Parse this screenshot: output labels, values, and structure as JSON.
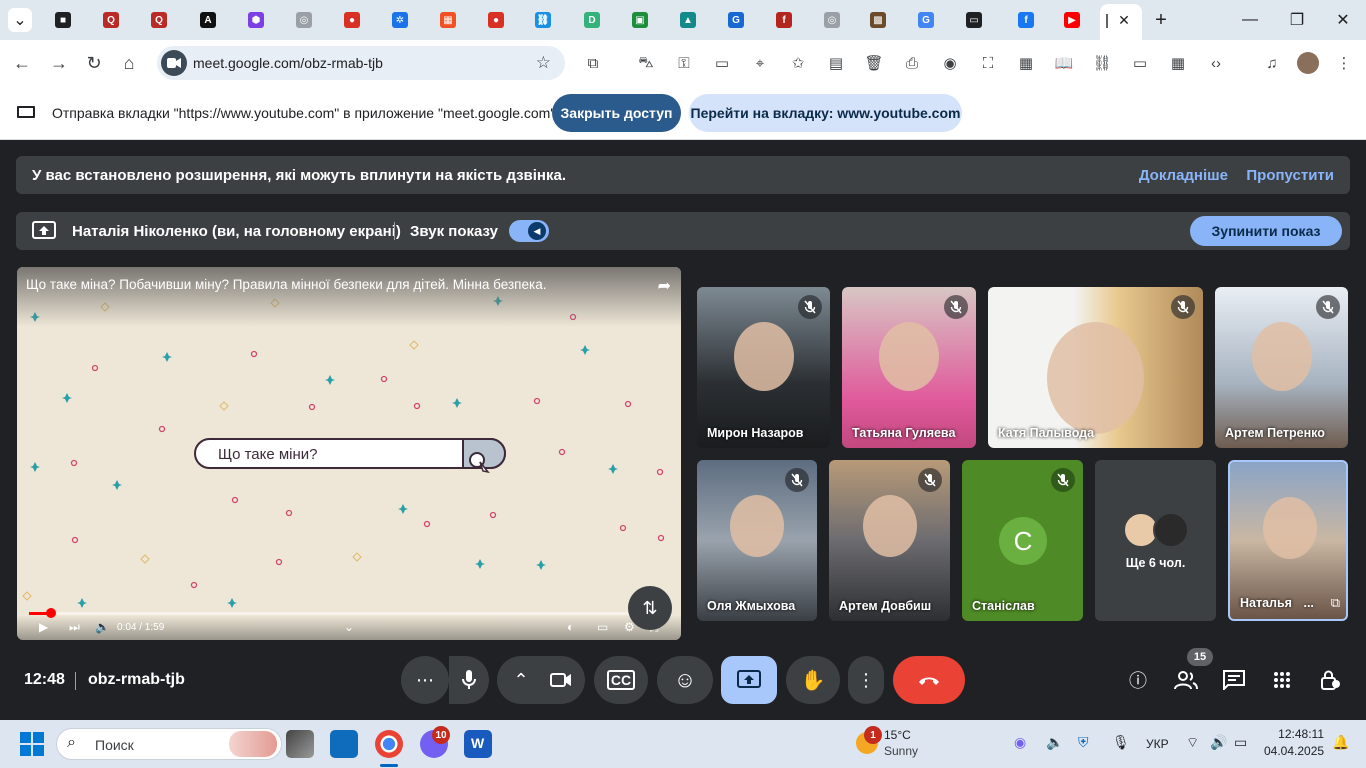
{
  "browser": {
    "url": "meet.google.com/obz-rmab-tjb",
    "tabs": [
      {
        "icon": "chrome-app-icon",
        "color": "#202124",
        "glyph": "■"
      },
      {
        "icon": "quora-icon",
        "color": "#b92b27",
        "glyph": "Q"
      },
      {
        "icon": "quora-icon",
        "color": "#b92b27",
        "glyph": "Q"
      },
      {
        "icon": "adobe-express-icon",
        "color": "#111",
        "glyph": "A"
      },
      {
        "icon": "hexagon-app-icon",
        "color": "#7b3fe4",
        "glyph": "⬢"
      },
      {
        "icon": "globe-icon",
        "color": "#9aa0a6",
        "glyph": "◎"
      },
      {
        "icon": "red-ball-icon",
        "color": "#d93025",
        "glyph": "●"
      },
      {
        "icon": "puzzle-blue-icon",
        "color": "#1a73e8",
        "glyph": "✲"
      },
      {
        "icon": "microsoft-icon",
        "color": "#f25022",
        "glyph": "▦"
      },
      {
        "icon": "red-ball-icon",
        "color": "#d93025",
        "glyph": "●"
      },
      {
        "icon": "link-app-icon",
        "color": "#1a8fe3",
        "glyph": "⛓"
      },
      {
        "icon": "d-app-icon",
        "color": "#33b37b",
        "glyph": "D"
      },
      {
        "icon": "classroom-icon",
        "color": "#1e8e3e",
        "glyph": "▣"
      },
      {
        "icon": "teams-icon",
        "color": "#138a8a",
        "glyph": "▲"
      },
      {
        "icon": "g-app-icon",
        "color": "#1967d2",
        "glyph": "G"
      },
      {
        "icon": "f-red-icon",
        "color": "#b3261e",
        "glyph": "f"
      },
      {
        "icon": "globe-icon",
        "color": "#9aa0a6",
        "glyph": "◎"
      },
      {
        "icon": "image-thumb-icon",
        "color": "#6b4b2a",
        "glyph": "▩"
      },
      {
        "icon": "google-icon",
        "color": "#4285f4",
        "glyph": "G"
      },
      {
        "icon": "slides-icon",
        "color": "#202124",
        "glyph": "▭"
      },
      {
        "icon": "facebook-icon",
        "color": "#1877f2",
        "glyph": "f"
      },
      {
        "icon": "youtube-icon",
        "color": "#ff0000",
        "glyph": "▶"
      }
    ]
  },
  "infobar": {
    "text": "Отправка вкладки \"https://www.youtube.com\" в приложение \"meet.google.com\"...",
    "stop_label": "Закрыть доступ",
    "goto_label": "Перейти на вкладку: www.youtube.com"
  },
  "extension_banner": {
    "text": "У вас встановлено розширення, які можуть вплинути на якість дзвінка.",
    "more_label": "Докладніше",
    "skip_label": "Пропустити"
  },
  "presentation_bar": {
    "presenter": "Наталія Ніколенко (ви, на головному екрані)",
    "sound_label": "Звук показу",
    "stop_label": "Зупинити показ"
  },
  "video": {
    "title": "Що таке міна? Побачивши міну? Правила мінної безпеки для дітей. Мінна безпека.",
    "search_text": "Що таке міни?",
    "time": "0:04 / 1:59",
    "progress": 0.034
  },
  "participants": [
    {
      "name": "Мирон Назаров",
      "muted": true
    },
    {
      "name": "Татьяна Гуляева",
      "muted": true
    },
    {
      "name": "Катя Палывода",
      "muted": true
    },
    {
      "name": "Артем Петренко",
      "muted": true
    },
    {
      "name": "Оля Жмыхова",
      "muted": true
    },
    {
      "name": "Артем Довбиш",
      "muted": true
    },
    {
      "name": "Станіслав",
      "initial": "С",
      "muted": true
    },
    {
      "name": "Ще 6 чол."
    },
    {
      "name": "Натальяᅟ..."
    }
  ],
  "meeting": {
    "time": "12:48",
    "code": "obz-rmab-tjb",
    "participant_count": "15"
  },
  "taskbar": {
    "search_placeholder": "Поиск",
    "viber_badge": "10",
    "weather_badge": "1",
    "temperature": "15°C",
    "weather": "Sunny",
    "language": "УКР",
    "time": "12:48:11",
    "date": "04.04.2025"
  },
  "colors": {
    "meet_bg": "#202124",
    "accent": "#8ab4f8",
    "leave": "#ea4335"
  }
}
